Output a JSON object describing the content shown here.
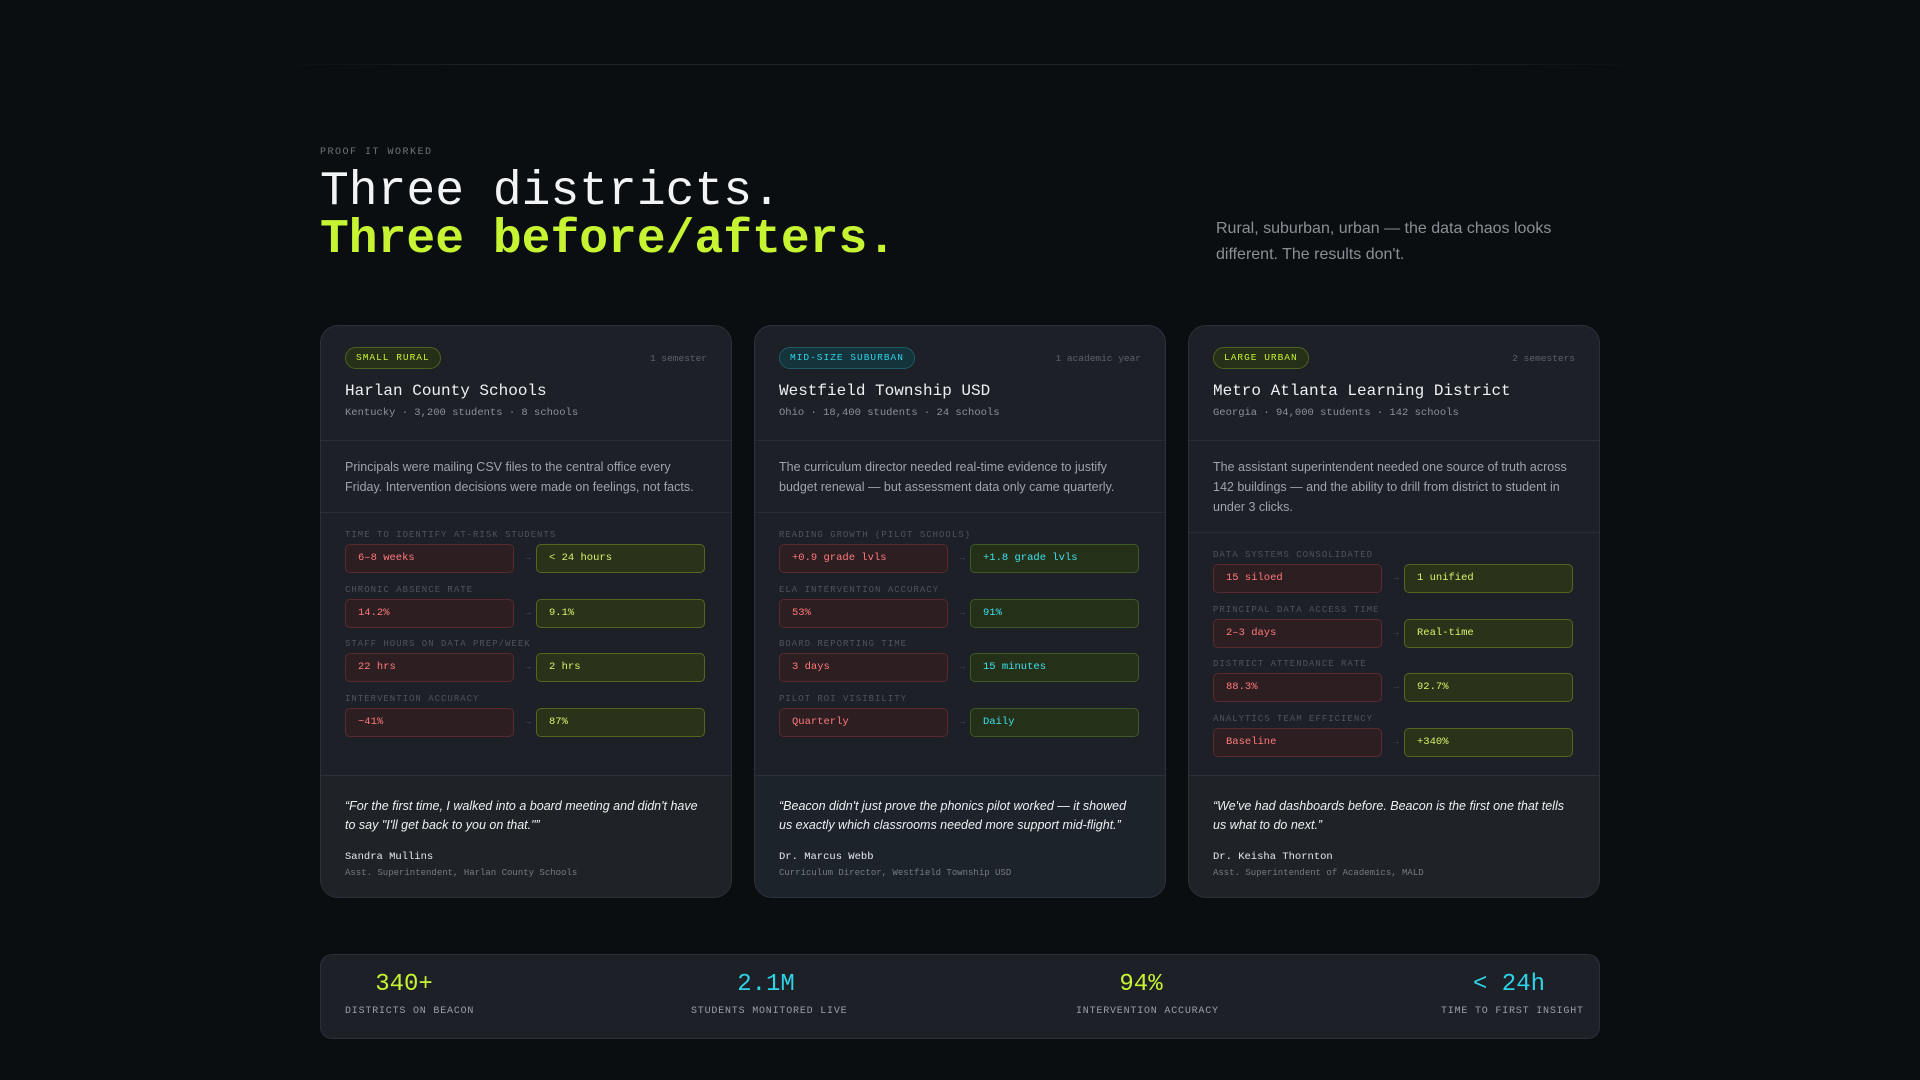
{
  "section": {
    "eyebrow": "PROOF IT WORKED",
    "title_line1": "Three districts.",
    "title_line2": "Three before/afters.",
    "intro": "Rural, suburban, urban — the data chaos looks different. The results don't."
  },
  "cards": [
    {
      "badge": "SMALL RURAL",
      "duration": "1 semester",
      "title": "Harlan County Schools",
      "subtitle": "Kentucky · 3,200 students · 8 schools",
      "description": "Principals were mailing CSV files to the central office every Friday. Intervention decisions were made on feelings, not facts.",
      "metrics": [
        {
          "label": "TIME TO IDENTIFY AT-RISK STUDENTS",
          "before": "6–8 weeks",
          "after": "< 24 hours"
        },
        {
          "label": "CHRONIC ABSENCE RATE",
          "before": "14.2%",
          "after": "9.1%"
        },
        {
          "label": "STAFF HOURS ON DATA PREP/WEEK",
          "before": "22 hrs",
          "after": "2 hrs"
        },
        {
          "label": "INTERVENTION ACCURACY",
          "before": "~41%",
          "after": "87%"
        }
      ],
      "quote": "“For the first time, I walked into a board meeting and didn't have to say \"I'll get back to you on that.\"”",
      "author": "Sandra Mullins",
      "role": "Asst. Superintendent, Harlan County Schools"
    },
    {
      "badge": "MID-SIZE SUBURBAN",
      "duration": "1 academic year",
      "title": "Westfield Township USD",
      "subtitle": "Ohio · 18,400 students · 24 schools",
      "description": "The curriculum director needed real-time evidence to justify budget renewal — but assessment data only came quarterly.",
      "metrics": [
        {
          "label": "READING GROWTH (PILOT SCHOOLS)",
          "before": "+0.9 grade lvls",
          "after": "+1.8 grade lvls"
        },
        {
          "label": "ELA INTERVENTION ACCURACY",
          "before": "53%",
          "after": "91%"
        },
        {
          "label": "BOARD REPORTING TIME",
          "before": "3 days",
          "after": "15 minutes"
        },
        {
          "label": "PILOT ROI VISIBILITY",
          "before": "Quarterly",
          "after": "Daily"
        }
      ],
      "quote": "“Beacon didn't just prove the phonics pilot worked — it showed us exactly which classrooms needed more support mid-flight.”",
      "author": "Dr. Marcus Webb",
      "role": "Curriculum Director, Westfield Township USD"
    },
    {
      "badge": "LARGE URBAN",
      "duration": "2 semesters",
      "title": "Metro Atlanta Learning District",
      "subtitle": "Georgia · 94,000 students · 142 schools",
      "description": "The assistant superintendent needed one source of truth across 142 buildings — and the ability to drill from district to student in under 3 clicks.",
      "metrics": [
        {
          "label": "DATA SYSTEMS CONSOLIDATED",
          "before": "15 siloed",
          "after": "1 unified"
        },
        {
          "label": "PRINCIPAL DATA ACCESS TIME",
          "before": "2–3 days",
          "after": "Real-time"
        },
        {
          "label": "DISTRICT ATTENDANCE RATE",
          "before": "88.3%",
          "after": "92.7%"
        },
        {
          "label": "ANALYTICS TEAM EFFICIENCY",
          "before": "Baseline",
          "after": "+340%"
        }
      ],
      "quote": "“We've had dashboards before. Beacon is the first one that tells us what to do next.”",
      "author": "Dr. Keisha Thornton",
      "role": "Asst. Superintendent of Academics, MALD"
    }
  ],
  "arrow_glyph": "→",
  "stats": [
    {
      "value": "340+",
      "label": "DISTRICTS ON BEACON"
    },
    {
      "value": "2.1M",
      "label": "STUDENTS MONITORED LIVE"
    },
    {
      "value": "94%",
      "label": "INTERVENTION ACCURACY"
    },
    {
      "value": "< 24h",
      "label": "TIME TO FIRST INSIGHT"
    }
  ],
  "colors": {
    "accent_lime": "#c6f432",
    "accent_cyan": "#2ed3e6",
    "before_red": "#ff7a7a",
    "background": "#0b0e10"
  }
}
